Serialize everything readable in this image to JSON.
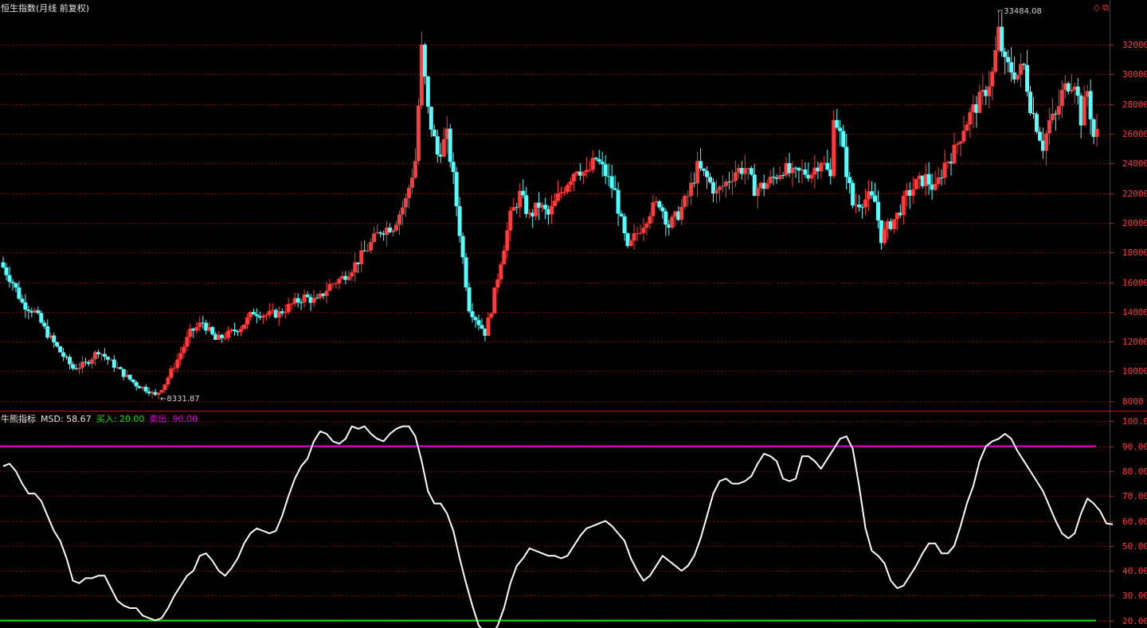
{
  "header": {
    "title": "恒生指数(月线 前复权)"
  },
  "indicator": {
    "name": "牛熊指标",
    "msd_label": "MSD: 58.67",
    "buy_label": "买入: 20.00",
    "sell_label": "卖出: 90.00"
  },
  "colors": {
    "up": "#ff3b3b",
    "down": "#54ffff",
    "grid": "#8b0000",
    "msd": "#ffffff",
    "buy": "#00e600",
    "sell": "#e600e6"
  },
  "annotations": {
    "high": "33484.08",
    "low": "8331.87"
  },
  "chart_data": [
    {
      "type": "candlestick",
      "title": "恒生指数(月线 前复权)",
      "ylim": [
        7400,
        34200
      ],
      "yticks": [
        "8000",
        "10000",
        "12000",
        "14000",
        "16000",
        "18000",
        "20000",
        "22000",
        "24000",
        "26000",
        "28000",
        "30000",
        "32000"
      ],
      "max_label": "33484.08",
      "min_label": "8331.87",
      "anchors": [
        [
          0,
          17000
        ],
        [
          3,
          16000
        ],
        [
          6,
          14600
        ],
        [
          10,
          14000
        ],
        [
          14,
          12500
        ],
        [
          18,
          11300
        ],
        [
          22,
          10200
        ],
        [
          26,
          10500
        ],
        [
          30,
          11400
        ],
        [
          34,
          10600
        ],
        [
          38,
          9800
        ],
        [
          42,
          9100
        ],
        [
          46,
          8700
        ],
        [
          48,
          8330
        ],
        [
          51,
          9200
        ],
        [
          55,
          10800
        ],
        [
          59,
          12600
        ],
        [
          63,
          13300
        ],
        [
          67,
          12100
        ],
        [
          71,
          12500
        ],
        [
          75,
          13000
        ],
        [
          79,
          14000
        ],
        [
          83,
          13800
        ],
        [
          87,
          13900
        ],
        [
          91,
          14500
        ],
        [
          95,
          15000
        ],
        [
          99,
          14700
        ],
        [
          103,
          15800
        ],
        [
          107,
          16300
        ],
        [
          111,
          17200
        ],
        [
          115,
          18300
        ],
        [
          119,
          19500
        ],
        [
          123,
          19800
        ],
        [
          127,
          21500
        ],
        [
          130,
          24200
        ],
        [
          132,
          31600
        ],
        [
          134,
          27500
        ],
        [
          137,
          24600
        ],
        [
          140,
          25800
        ],
        [
          142,
          23000
        ],
        [
          145,
          17600
        ],
        [
          147,
          14300
        ],
        [
          149,
          13600
        ],
        [
          152,
          12600
        ],
        [
          154,
          14200
        ],
        [
          157,
          17500
        ],
        [
          160,
          20400
        ],
        [
          163,
          21900
        ],
        [
          166,
          20400
        ],
        [
          169,
          21200
        ],
        [
          172,
          20500
        ],
        [
          175,
          21700
        ],
        [
          178,
          22800
        ],
        [
          181,
          23800
        ],
        [
          184,
          23200
        ],
        [
          187,
          24300
        ],
        [
          190,
          23300
        ],
        [
          193,
          22000
        ],
        [
          195,
          20000
        ],
        [
          197,
          18100
        ],
        [
          199,
          19000
        ],
        [
          202,
          20000
        ],
        [
          204,
          20800
        ],
        [
          207,
          21400
        ],
        [
          210,
          19800
        ],
        [
          213,
          20600
        ],
        [
          216,
          21800
        ],
        [
          219,
          23700
        ],
        [
          222,
          23000
        ],
        [
          225,
          22000
        ],
        [
          228,
          22700
        ],
        [
          231,
          23500
        ],
        [
          234,
          23700
        ],
        [
          237,
          22300
        ],
        [
          240,
          22500
        ],
        [
          243,
          23000
        ],
        [
          246,
          23700
        ],
        [
          249,
          23200
        ],
        [
          252,
          23400
        ],
        [
          255,
          23400
        ],
        [
          258,
          24300
        ],
        [
          261,
          23000
        ],
        [
          262,
          27500
        ],
        [
          264,
          25900
        ],
        [
          266,
          23500
        ],
        [
          268,
          21200
        ],
        [
          271,
          21500
        ],
        [
          273,
          21700
        ],
        [
          275,
          21400
        ],
        [
          277,
          19000
        ],
        [
          279,
          19700
        ],
        [
          282,
          20500
        ],
        [
          285,
          21800
        ],
        [
          288,
          22600
        ],
        [
          291,
          23000
        ],
        [
          294,
          22200
        ],
        [
          297,
          24000
        ],
        [
          300,
          24800
        ],
        [
          303,
          26500
        ],
        [
          306,
          27600
        ],
        [
          309,
          28500
        ],
        [
          312,
          30000
        ],
        [
          314,
          32800
        ],
        [
          316,
          30600
        ],
        [
          318,
          30300
        ],
        [
          320,
          30000
        ],
        [
          322,
          30500
        ],
        [
          324,
          28000
        ],
        [
          326,
          26600
        ],
        [
          328,
          25200
        ],
        [
          330,
          26800
        ],
        [
          332,
          27100
        ],
        [
          334,
          28700
        ],
        [
          336,
          29400
        ],
        [
          338,
          29700
        ],
        [
          340,
          27000
        ],
        [
          342,
          28900
        ],
        [
          344,
          25800
        ],
        [
          345,
          26000
        ]
      ]
    },
    {
      "type": "line",
      "title": "牛熊指标",
      "ylim": [
        17,
        103
      ],
      "yticks": [
        "20.00",
        "30.00",
        "40.00",
        "50.00",
        "60.00",
        "70.00",
        "80.00",
        "90.00",
        "100.0"
      ],
      "buy_level": 20,
      "sell_level": 90,
      "series": [
        {
          "name": "MSD",
          "points": [
            [
              0,
              82
            ],
            [
              2,
              83
            ],
            [
              4,
              80
            ],
            [
              6,
              75
            ],
            [
              8,
              71
            ],
            [
              10,
              71
            ],
            [
              12,
              68
            ],
            [
              14,
              62
            ],
            [
              16,
              56
            ],
            [
              18,
              52
            ],
            [
              20,
              45
            ],
            [
              22,
              36
            ],
            [
              24,
              35
            ],
            [
              26,
              37
            ],
            [
              28,
              37
            ],
            [
              30,
              38
            ],
            [
              32,
              38
            ],
            [
              34,
              33
            ],
            [
              36,
              28
            ],
            [
              38,
              26
            ],
            [
              40,
              25
            ],
            [
              42,
              25
            ],
            [
              44,
              22
            ],
            [
              46,
              21
            ],
            [
              48,
              20
            ],
            [
              50,
              21
            ],
            [
              52,
              25
            ],
            [
              54,
              30
            ],
            [
              56,
              34
            ],
            [
              58,
              38
            ],
            [
              60,
              40
            ],
            [
              62,
              46
            ],
            [
              64,
              47
            ],
            [
              66,
              44
            ],
            [
              68,
              40
            ],
            [
              70,
              38
            ],
            [
              72,
              41
            ],
            [
              74,
              45
            ],
            [
              76,
              51
            ],
            [
              78,
              55
            ],
            [
              80,
              57
            ],
            [
              82,
              56
            ],
            [
              84,
              55
            ],
            [
              86,
              56
            ],
            [
              88,
              62
            ],
            [
              90,
              70
            ],
            [
              92,
              77
            ],
            [
              94,
              82
            ],
            [
              96,
              85
            ],
            [
              98,
              92
            ],
            [
              100,
              96
            ],
            [
              102,
              95
            ],
            [
              104,
              92
            ],
            [
              106,
              91
            ],
            [
              108,
              93
            ],
            [
              110,
              98
            ],
            [
              112,
              97
            ],
            [
              114,
              98
            ],
            [
              116,
              95
            ],
            [
              118,
              93
            ],
            [
              120,
              92
            ],
            [
              122,
              95
            ],
            [
              124,
              97
            ],
            [
              126,
              98
            ],
            [
              128,
              98
            ],
            [
              130,
              94
            ],
            [
              132,
              84
            ],
            [
              134,
              72
            ],
            [
              136,
              67
            ],
            [
              138,
              67
            ],
            [
              140,
              63
            ],
            [
              142,
              56
            ],
            [
              144,
              45
            ],
            [
              146,
              35
            ],
            [
              148,
              26
            ],
            [
              150,
              18
            ],
            [
              152,
              15
            ],
            [
              154,
              14
            ],
            [
              156,
              18
            ],
            [
              158,
              25
            ],
            [
              160,
              35
            ],
            [
              162,
              42
            ],
            [
              164,
              45
            ],
            [
              166,
              49
            ],
            [
              168,
              48
            ],
            [
              170,
              47
            ],
            [
              172,
              46
            ],
            [
              174,
              46
            ],
            [
              176,
              45
            ],
            [
              178,
              46
            ],
            [
              180,
              50
            ],
            [
              182,
              54
            ],
            [
              184,
              57
            ],
            [
              186,
              58
            ],
            [
              188,
              59
            ],
            [
              190,
              60
            ],
            [
              192,
              58
            ],
            [
              194,
              55
            ],
            [
              196,
              52
            ],
            [
              198,
              45
            ],
            [
              200,
              40
            ],
            [
              202,
              36
            ],
            [
              204,
              38
            ],
            [
              206,
              42
            ],
            [
              208,
              46
            ],
            [
              210,
              44
            ],
            [
              212,
              42
            ],
            [
              214,
              40
            ],
            [
              216,
              42
            ],
            [
              218,
              46
            ],
            [
              220,
              53
            ],
            [
              222,
              62
            ],
            [
              224,
              71
            ],
            [
              226,
              76
            ],
            [
              228,
              77
            ],
            [
              230,
              75
            ],
            [
              232,
              75
            ],
            [
              234,
              76
            ],
            [
              236,
              78
            ],
            [
              238,
              83
            ],
            [
              240,
              87
            ],
            [
              242,
              86
            ],
            [
              244,
              84
            ],
            [
              246,
              77
            ],
            [
              248,
              76
            ],
            [
              250,
              77
            ],
            [
              252,
              86
            ],
            [
              254,
              86
            ],
            [
              256,
              84
            ],
            [
              258,
              81
            ],
            [
              260,
              85
            ],
            [
              262,
              89
            ],
            [
              264,
              93
            ],
            [
              266,
              94
            ],
            [
              268,
              89
            ],
            [
              270,
              74
            ],
            [
              272,
              57
            ],
            [
              274,
              48
            ],
            [
              276,
              46
            ],
            [
              278,
              43
            ],
            [
              280,
              36
            ],
            [
              282,
              33
            ],
            [
              284,
              34
            ],
            [
              286,
              38
            ],
            [
              288,
              42
            ],
            [
              290,
              47
            ],
            [
              292,
              51
            ],
            [
              294,
              51
            ],
            [
              296,
              47
            ],
            [
              298,
              47
            ],
            [
              300,
              50
            ],
            [
              302,
              58
            ],
            [
              304,
              67
            ],
            [
              306,
              74
            ],
            [
              308,
              84
            ],
            [
              310,
              90
            ],
            [
              312,
              92
            ],
            [
              314,
              93
            ],
            [
              316,
              95
            ],
            [
              318,
              93
            ],
            [
              320,
              88
            ],
            [
              322,
              84
            ],
            [
              324,
              80
            ],
            [
              326,
              76
            ],
            [
              328,
              72
            ],
            [
              330,
              66
            ],
            [
              332,
              60
            ],
            [
              334,
              55
            ],
            [
              336,
              53
            ],
            [
              338,
              55
            ],
            [
              340,
              63
            ],
            [
              342,
              69
            ],
            [
              344,
              67
            ],
            [
              346,
              64
            ],
            [
              348,
              59
            ],
            [
              350,
              58.67
            ]
          ]
        }
      ]
    }
  ]
}
